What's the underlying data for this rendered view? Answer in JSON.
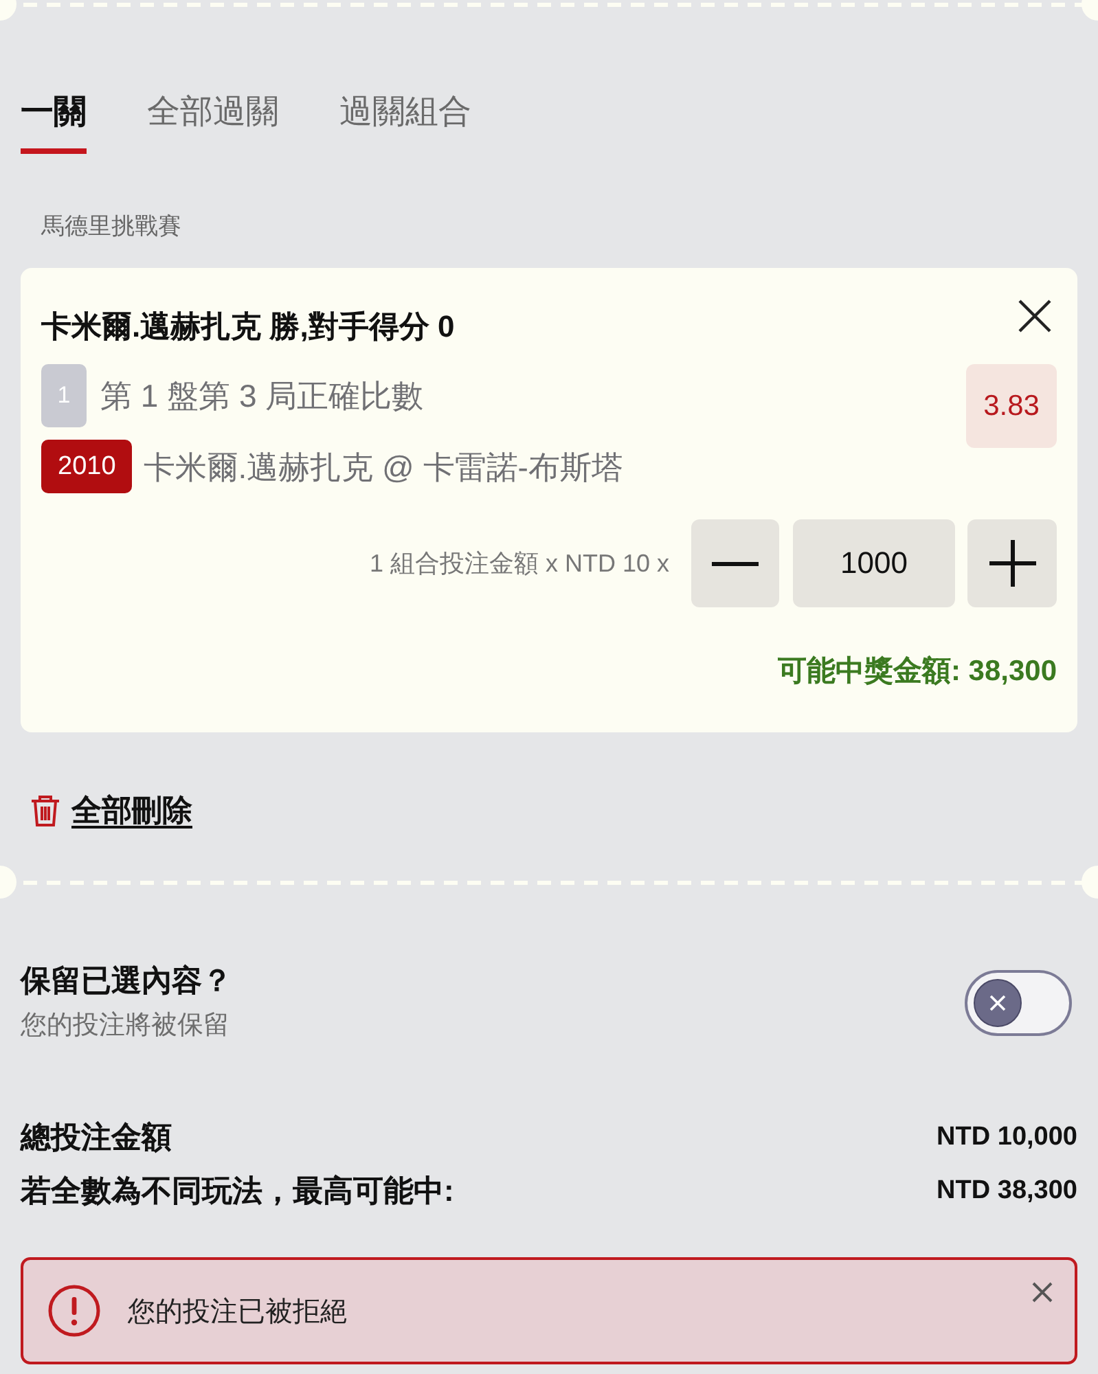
{
  "tabs": [
    {
      "label": "一關",
      "selected": true
    },
    {
      "label": "全部過關",
      "selected": false
    },
    {
      "label": "過關組合",
      "selected": false
    }
  ],
  "event": "馬德里挑戰賽",
  "selection": {
    "title": "卡米爾.邁赫扎克 勝,對手得分 0",
    "leg_number": "1",
    "market": "第 1 盤第 3 局正確比數",
    "odds": "3.83",
    "match_code": "2010",
    "match": "卡米爾.邁赫扎克 @ 卡雷諾-布斯塔",
    "stake_label": "1 組合投注金額 x NTD 10 x",
    "stake_value": "1000",
    "potential_win": "可能中獎金額: 38,300"
  },
  "remove_all": "全部刪除",
  "keep_selections": {
    "title": "保留已選內容？",
    "subtitle": "您的投注將被保留",
    "on": false
  },
  "summary": [
    {
      "label": "總投注金額",
      "value": "NTD 10,000"
    },
    {
      "label": "若全數為不同玩法，最高可能中:",
      "value": "NTD 38,300"
    }
  ],
  "alert": {
    "kind": "error",
    "message": "您的投注已被拒絕"
  }
}
